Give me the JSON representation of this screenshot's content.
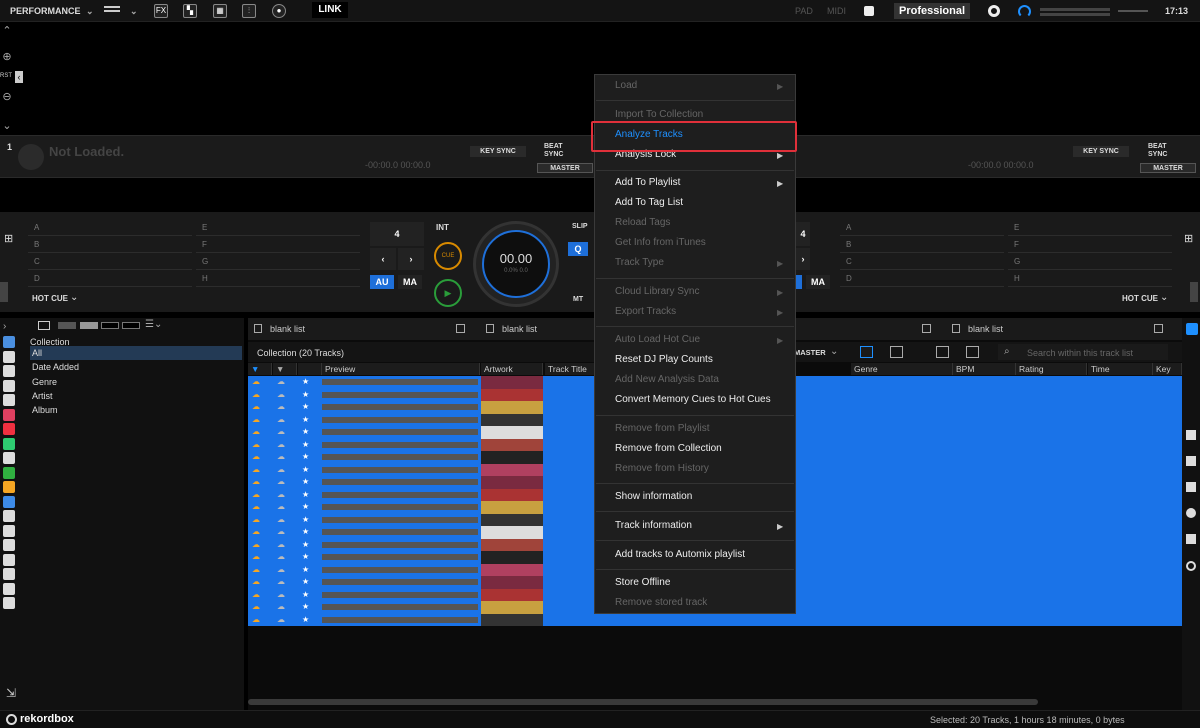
{
  "topbar": {
    "mode": "PERFORMANCE",
    "fx": "FX",
    "link": "LINK",
    "pad": "PAD",
    "midi": "MIDI",
    "plan": "Professional",
    "clock": "17:13"
  },
  "left_strip": {
    "rst": "RST"
  },
  "deck": {
    "number": "1",
    "not_loaded": "Not Loaded.",
    "key_sync": "KEY SYNC",
    "beat_sync_1": "BEAT",
    "beat_sync_2": "SYNC",
    "master": "MASTER",
    "time": "-00:00.0  00:00.0"
  },
  "cue": {
    "pads_left": [
      "A",
      "B",
      "C",
      "D"
    ],
    "pads_right": [
      "E",
      "F",
      "G",
      "H"
    ],
    "hot_cue_label": "HOT CUE",
    "beat_count": "4",
    "int": "INT",
    "au": "AU",
    "ma": "MA",
    "cue_btn": "CUE",
    "slip": "SLIP",
    "q": "Q",
    "mt": "MT",
    "jog_time": "00.00",
    "jog_sub": "0.0%  0.0"
  },
  "sidebar": {
    "root": "Collection",
    "items": [
      "All",
      "Date Added",
      "Genre",
      "Artist",
      "Album"
    ]
  },
  "browser": {
    "tab1": "blank list",
    "tab2": "blank list",
    "tab3": "blank list",
    "collection_title": "Collection (20 Tracks)",
    "master_label": "MASTER",
    "search_placeholder": "Search within this track list",
    "columns": [
      "Preview",
      "Artwork",
      "Track Title",
      "Genre",
      "BPM",
      "Rating",
      "Time",
      "Key"
    ]
  },
  "context_menu": {
    "items": [
      {
        "label": "Load",
        "state": "disabled",
        "arrow": true
      },
      {
        "label": "Import To Collection",
        "state": "disabled"
      },
      {
        "label": "Analyze Tracks",
        "state": "highlight"
      },
      {
        "label": "Analysis Lock",
        "state": "enabled",
        "arrow": true
      },
      {
        "label": "Add To Playlist",
        "state": "enabled",
        "arrow": true
      },
      {
        "label": "Add To Tag List",
        "state": "enabled"
      },
      {
        "label": "Reload Tags",
        "state": "disabled"
      },
      {
        "label": "Get Info from iTunes",
        "state": "disabled"
      },
      {
        "label": "Track Type",
        "state": "disabled",
        "arrow": true
      },
      {
        "label": "Cloud Library Sync",
        "state": "disabled",
        "arrow": true
      },
      {
        "label": "Export Tracks",
        "state": "disabled",
        "arrow": true
      },
      {
        "label": "Auto Load Hot Cue",
        "state": "disabled",
        "arrow": true
      },
      {
        "label": "Reset DJ Play Counts",
        "state": "enabled"
      },
      {
        "label": "Add New Analysis Data",
        "state": "disabled"
      },
      {
        "label": "Convert Memory Cues to Hot Cues",
        "state": "enabled"
      },
      {
        "label": "Remove from Playlist",
        "state": "disabled"
      },
      {
        "label": "Remove from Collection",
        "state": "enabled"
      },
      {
        "label": "Remove from History",
        "state": "disabled"
      },
      {
        "label": "Show information",
        "state": "enabled"
      },
      {
        "label": "Track information",
        "state": "enabled",
        "arrow": true
      },
      {
        "label": "Add tracks to Automix playlist",
        "state": "enabled"
      },
      {
        "label": "Store Offline",
        "state": "enabled"
      },
      {
        "label": "Remove stored track",
        "state": "disabled"
      }
    ]
  },
  "status": {
    "logo": "rekordbox",
    "summary": "Selected: 20 Tracks, 1 hours 18 minutes, 0 bytes"
  },
  "colors": {
    "accent": "#1e90ff",
    "selection": "#1a73e8",
    "highlight_box": "#e0303a"
  }
}
